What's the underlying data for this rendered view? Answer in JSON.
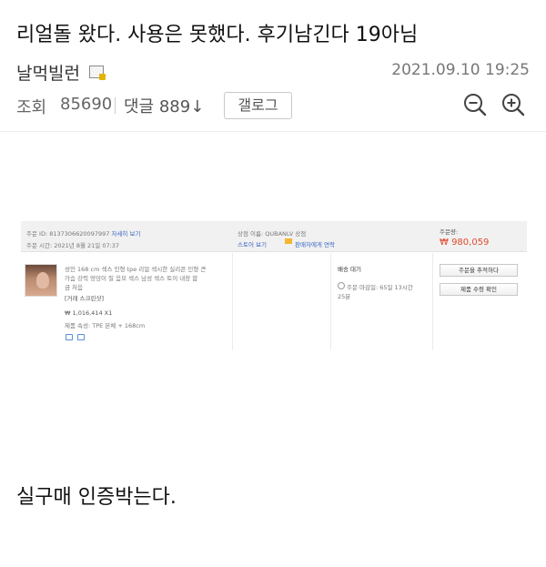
{
  "post": {
    "title": "리얼돌 왔다. 사용은 못했다. 후기남긴다 19아님",
    "author": "날먹빌런",
    "date": "2021.09.10 19:25",
    "views_label": "조회",
    "views_count": "85690",
    "comments_label": "댓글",
    "comments_count": "889",
    "comments_arrow": "↓",
    "gallery_button": "갤로그",
    "body_text": "실구매 인증박는다.",
    "icons": [
      "author-badge-icon",
      "zoom-out-icon",
      "zoom-in-icon"
    ]
  },
  "order_screenshot": {
    "order_id_label": "주문 ID: 8137306620097997",
    "order_detail_link": "자세히 보기",
    "order_time": "주문 시간: 2021년 8월 21일 07:37",
    "seller_name": "상점 이름: QUBANLV 상점",
    "store_link": "스토어 보기",
    "contact_seller": "판매자에게 연락",
    "amount_label": "주문량:",
    "amount": "₩ 980,059",
    "product_desc_1": "성인 168 cm 섹스 인형 tpe 리얼 섹시한 실리콘 인형 큰",
    "product_desc_2": "가슴 강력 엉덩이 질 음모 섹스 남성 섹스 토이 내장 합",
    "product_desc_3": "금 처음",
    "product_tag": "[거래 스크린샷]",
    "product_price": "₩ 1,016,414 X1",
    "product_attr": "제품 속성: TPE 본체 + 168cm",
    "shipping_status": "배송 대기",
    "deadline_1": "주문 마감일: 65일 13시간",
    "deadline_2": "25분",
    "track_button": "주문을 추적하다",
    "confirm_button": "제품 수령 확인",
    "colors": {
      "price_red": "#e04a2f",
      "link_blue": "#3a66c4",
      "header_bg": "#f1f1f1"
    }
  }
}
